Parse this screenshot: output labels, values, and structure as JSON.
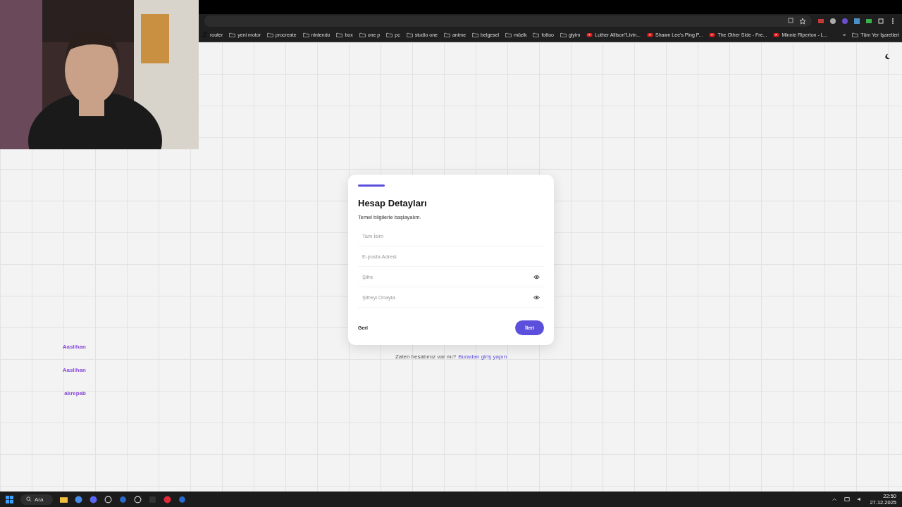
{
  "bookmarks": [
    {
      "label": "router",
      "kind": "site"
    },
    {
      "label": "yeni motor",
      "kind": "folder"
    },
    {
      "label": "procreate",
      "kind": "folder"
    },
    {
      "label": "nintendo",
      "kind": "folder"
    },
    {
      "label": "box",
      "kind": "folder"
    },
    {
      "label": "one p",
      "kind": "folder"
    },
    {
      "label": "pc",
      "kind": "folder"
    },
    {
      "label": "studio one",
      "kind": "folder"
    },
    {
      "label": "anime",
      "kind": "folder"
    },
    {
      "label": "belgesel",
      "kind": "folder"
    },
    {
      "label": "müzik",
      "kind": "folder"
    },
    {
      "label": "fottoo",
      "kind": "folder"
    },
    {
      "label": "giyim",
      "kind": "folder"
    },
    {
      "label": "Luther Allison\"Livin...",
      "kind": "video"
    },
    {
      "label": "Shawn Lee's Ping P...",
      "kind": "video"
    },
    {
      "label": "The Other Side - Fre...",
      "kind": "video"
    },
    {
      "label": "Minnie Riperton - L...",
      "kind": "video"
    }
  ],
  "bookmarks_overflow": "»",
  "all_bookmarks": "Tüm Yer İşaretleri",
  "card": {
    "title": "Hesap Detayları",
    "subtitle": "Temel bilgilerle başlayalım.",
    "fields": [
      {
        "placeholder": "Tam İsim",
        "kind": "text"
      },
      {
        "placeholder": "E-posta Adresi",
        "kind": "text"
      },
      {
        "placeholder": "Şifre",
        "kind": "password"
      },
      {
        "placeholder": "Şifreyi Onayla",
        "kind": "password"
      }
    ],
    "back_button": "Geri",
    "next_button": "İleri"
  },
  "login_prompt": {
    "text": "Zaten hesabınız var mı?",
    "link": "Buradan giriş yapın"
  },
  "chat": [
    {
      "user": "Aaslihan",
      "color": "#8a4fd8"
    },
    {
      "user": "Aaslihan",
      "color": "#8a4fd8"
    },
    {
      "user": "akrepab",
      "color": "#8a4fd8"
    }
  ],
  "taskbar": {
    "search": "Ara",
    "time": "22:50",
    "date": "27.12.2025"
  }
}
